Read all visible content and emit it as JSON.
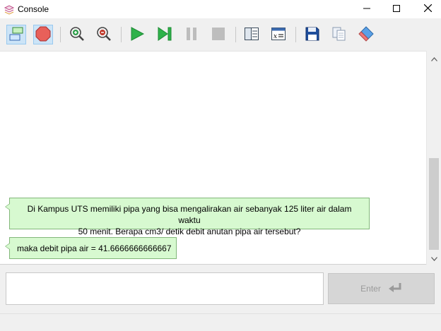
{
  "window": {
    "title": "Console",
    "icon": "console-app-icon",
    "controls": [
      "minimize-icon",
      "maximize-icon",
      "close-icon"
    ]
  },
  "toolbar": {
    "buttons": [
      {
        "icon": "console-mode-icon",
        "active": true
      },
      {
        "icon": "stop-icon",
        "active": true
      },
      {
        "icon": "zoom-in-icon",
        "active": false
      },
      {
        "icon": "zoom-out-icon",
        "active": false
      },
      {
        "icon": "run-icon",
        "active": false
      },
      {
        "icon": "step-icon",
        "active": false
      },
      {
        "icon": "pause-icon",
        "active": false,
        "disabled": true
      },
      {
        "icon": "stop-square-icon",
        "active": false,
        "disabled": true
      },
      {
        "icon": "layout-icon",
        "active": false
      },
      {
        "icon": "variables-icon",
        "active": false
      },
      {
        "icon": "save-icon",
        "active": false
      },
      {
        "icon": "copy-icon",
        "active": false
      },
      {
        "icon": "eraser-icon",
        "active": false
      }
    ]
  },
  "console": {
    "messages": [
      {
        "line1": "Di Kampus UTS memiliki pipa yang bisa mengalirakan air sebanyak 125 liter air dalam waktu",
        "line2": "50 menit. Berapa cm3/ detik debit anutan pipa air tersebut?"
      },
      {
        "text": "maka debit pipa air = 41.6666666666667"
      }
    ]
  },
  "input": {
    "value": "",
    "placeholder": ""
  },
  "enter_button": {
    "label": "Enter",
    "enabled": false
  },
  "colors": {
    "bubble_fill": "#d7f9d0",
    "bubble_border": "#82b77a",
    "active_button": "#cce4f7"
  }
}
